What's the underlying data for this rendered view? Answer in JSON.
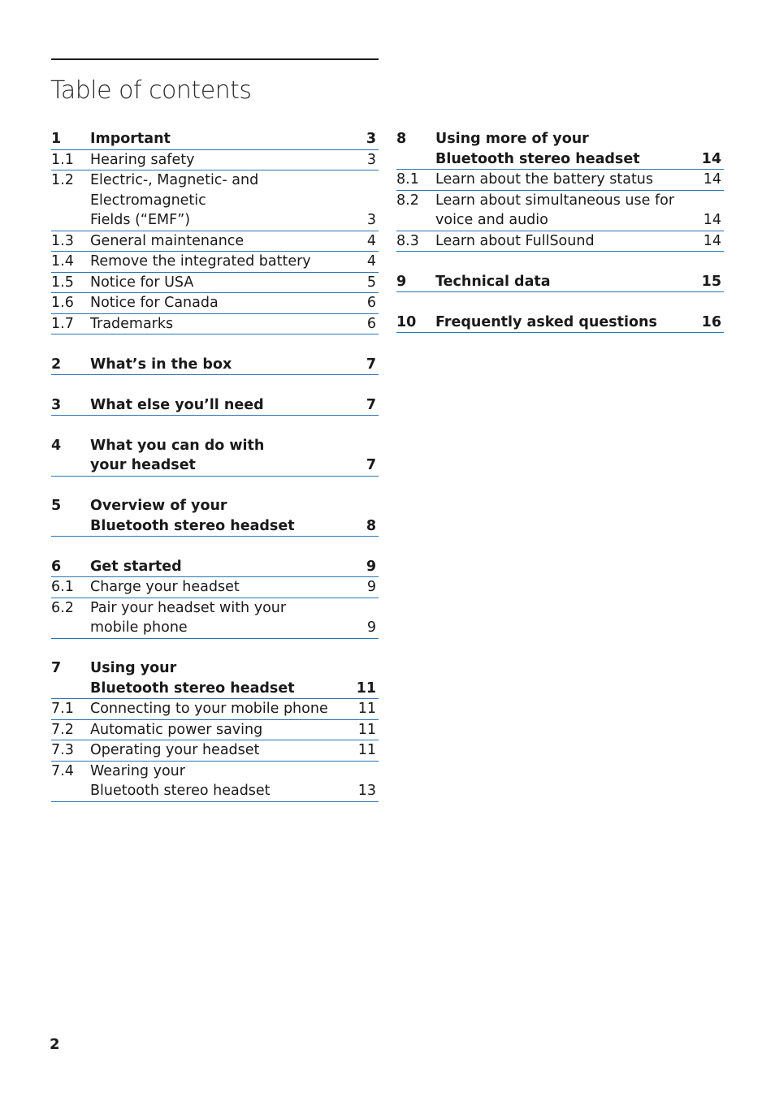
{
  "title": "Table of contents",
  "page_number": "2",
  "left_column": [
    {
      "type": "chapter",
      "num": "1",
      "lines": [
        "Important"
      ],
      "page": "3"
    },
    {
      "type": "section",
      "num": "1.1",
      "lines": [
        "Hearing safety"
      ],
      "page": "3"
    },
    {
      "type": "section",
      "num": "1.2",
      "lines": [
        "Electric-, Magnetic- and Electromagnetic",
        "Fields (“EMF”)"
      ],
      "page": "3"
    },
    {
      "type": "section",
      "num": "1.3",
      "lines": [
        "General maintenance"
      ],
      "page": "4"
    },
    {
      "type": "section",
      "num": "1.4",
      "lines": [
        "Remove the integrated battery"
      ],
      "page": "4"
    },
    {
      "type": "section",
      "num": "1.5",
      "lines": [
        "Notice for USA"
      ],
      "page": "5"
    },
    {
      "type": "section",
      "num": "1.6",
      "lines": [
        "Notice for Canada"
      ],
      "page": "6"
    },
    {
      "type": "section",
      "num": "1.7",
      "lines": [
        "Trademarks"
      ],
      "page": "6"
    },
    {
      "type": "chapter",
      "num": "2",
      "lines": [
        "What’s in the box"
      ],
      "page": "7"
    },
    {
      "type": "chapter",
      "num": "3",
      "lines": [
        "What else you’ll need"
      ],
      "page": "7"
    },
    {
      "type": "chapter",
      "num": "4",
      "lines": [
        "What you can do with",
        "your headset"
      ],
      "page": "7"
    },
    {
      "type": "chapter",
      "num": "5",
      "lines": [
        "Overview of your",
        "Bluetooth stereo headset"
      ],
      "page": "8"
    },
    {
      "type": "chapter",
      "num": "6",
      "lines": [
        "Get started"
      ],
      "page": "9"
    },
    {
      "type": "section",
      "num": "6.1",
      "lines": [
        "Charge your headset"
      ],
      "page": "9"
    },
    {
      "type": "section",
      "num": "6.2",
      "lines": [
        "Pair your headset with your",
        "mobile phone"
      ],
      "page": "9"
    },
    {
      "type": "chapter",
      "num": "7",
      "lines": [
        "Using your",
        "Bluetooth stereo headset"
      ],
      "page": "11"
    },
    {
      "type": "section",
      "num": "7.1",
      "lines": [
        "Connecting to your mobile phone"
      ],
      "page": "11"
    },
    {
      "type": "section",
      "num": "7.2",
      "lines": [
        "Automatic power saving"
      ],
      "page": "11"
    },
    {
      "type": "section",
      "num": "7.3",
      "lines": [
        "Operating your headset"
      ],
      "page": "11"
    },
    {
      "type": "section",
      "num": "7.4",
      "lines": [
        "Wearing your",
        "Bluetooth stereo headset"
      ],
      "page": "13"
    }
  ],
  "right_column": [
    {
      "type": "chapter",
      "num": "8",
      "lines": [
        "Using more of your",
        "Bluetooth stereo headset"
      ],
      "page": "14"
    },
    {
      "type": "section",
      "num": "8.1",
      "lines": [
        "Learn about the battery status"
      ],
      "page": "14"
    },
    {
      "type": "section",
      "num": "8.2",
      "lines": [
        "Learn about simultaneous use for",
        "voice and audio"
      ],
      "page": "14"
    },
    {
      "type": "section",
      "num": "8.3",
      "lines": [
        "Learn about FullSound"
      ],
      "page": "14"
    },
    {
      "type": "chapter",
      "num": "9",
      "lines": [
        "Technical data"
      ],
      "page": "15"
    },
    {
      "type": "chapter",
      "num": "10",
      "lines": [
        "Frequently asked questions"
      ],
      "page": "16"
    }
  ]
}
